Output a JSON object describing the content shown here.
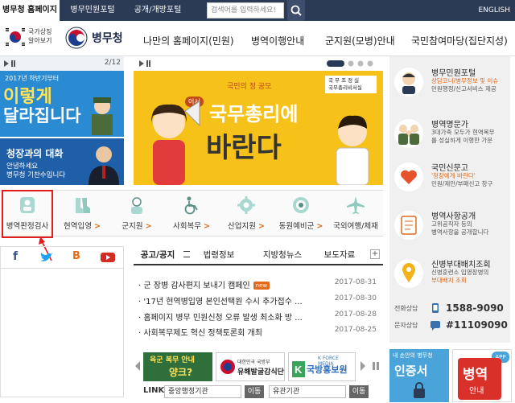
{
  "topbar": {
    "tabs": [
      "병무청 홈페이지",
      "병무민원포털",
      "공개/개방포털"
    ],
    "search_placeholder": "검색어를 입력하세요!",
    "english": "ENGLISH"
  },
  "header": {
    "logo_small_line1": "국가상징",
    "logo_small_line2": "알아보기",
    "logo_name": "병무청",
    "nav": [
      "나만의 홈페이지(민원)",
      "병역이행안내",
      "군지원(모병)안내",
      "국민참여마당(집단지성)"
    ]
  },
  "left_banner": {
    "counter": "2/12",
    "b1_small": "2017년 하반기부터",
    "b1_line1": "이렇게",
    "b1_line2": "달라집니다",
    "b2_title": "청장과의 대화",
    "b2_line1": "안녕하세요",
    "b2_line2": "병무청 기찬수입니다"
  },
  "center_banner": {
    "small": "국민의 정 공모",
    "logo_line1": "국 무 조 정 실",
    "logo_line2": "국무총리비서실",
    "tag": "어서",
    "line1": "국무총리에",
    "line2": "바란다"
  },
  "quick_icons": [
    {
      "label": "병역판정검사",
      "icon": "person-check-icon"
    },
    {
      "label": "현역입영",
      "icon": "boots-icon"
    },
    {
      "label": "군지원",
      "icon": "soldier-icon"
    },
    {
      "label": "사회복무",
      "icon": "wheelchair-icon"
    },
    {
      "label": "산업지원",
      "icon": "gear-icon"
    },
    {
      "label": "동원예비군",
      "icon": "emblem-icon"
    },
    {
      "label": "국외여행/체재",
      "icon": "airplane-icon"
    }
  ],
  "social": [
    "f",
    "t",
    "B",
    "yt"
  ],
  "notice_tabs": [
    "공고/공지",
    "법령정보",
    "지방청뉴스",
    "보도자료"
  ],
  "notices": [
    {
      "title": "군 장병 감사편지 보내기 캠페인",
      "new": "new",
      "date": "2017-08-31"
    },
    {
      "title": "'17년 현역병입영 본인선택원 수시 추가접수 ...",
      "new": "",
      "date": "2017-08-30"
    },
    {
      "title": "홈페이지 병무 민원신청 오류 발생 최소화 방 ...",
      "new": "",
      "date": "2017-08-28"
    },
    {
      "title": "사회복무제도 혁신 정책토론회 개최",
      "new": "",
      "date": "2017-08-25"
    }
  ],
  "bottom_banners": {
    "b1_line1": "육군 복무 안내",
    "b1_line2": "양크?",
    "b2_top": "대한민국 국방부",
    "b2_main": "유해발굴감식단",
    "b3_top": "K FORCE MEDIA",
    "b3_main": "국방홍보원"
  },
  "linkbar": {
    "label": "LINK",
    "select1": "중앙행정기관",
    "go1": "이동",
    "select2": "유관기관",
    "go2": "이동"
  },
  "right_items": [
    {
      "title": "병무민원포털",
      "desc": [
        "상담코너/병무정보 및 이슈",
        "민원행정/신고서비스 제공"
      ],
      "icon": "advisor-icon"
    },
    {
      "title": "병역명문가",
      "desc": [
        "3대가족 모두가 현역복무",
        "를 성실하게 이행한 가문"
      ],
      "icon": "family-icon"
    },
    {
      "title": "국민신문고",
      "desc": [
        "'청장에게 바란다'",
        "민원/제안/부패신고 창구"
      ],
      "icon": "heart-icon"
    },
    {
      "title": "병역사항공개",
      "desc": [
        "고위공직자 등의",
        "병역사항을 공개합니다"
      ],
      "icon": "document-icon"
    },
    {
      "title": "신병부대배치조회",
      "desc": [
        "신병훈련소 입영장병의",
        "부대배치 조회"
      ],
      "icon": "map-pin-icon"
    }
  ],
  "contacts": [
    {
      "label": "전화상담",
      "value": "1588-9090",
      "icon": "phone-icon"
    },
    {
      "label": "문자상담",
      "value": "#11109090",
      "icon": "sms-icon"
    }
  ],
  "right_bottom": {
    "title": "내 손안의 병무청",
    "cert": "인증서",
    "app_badge": "APP",
    "app_line1": "병역",
    "app_line2": "안내"
  },
  "colors": {
    "topbar": "#2b3a55",
    "accent": "#e06a1b",
    "highlight": "#e41b1b",
    "banner_yellow": "#f6c21a"
  }
}
